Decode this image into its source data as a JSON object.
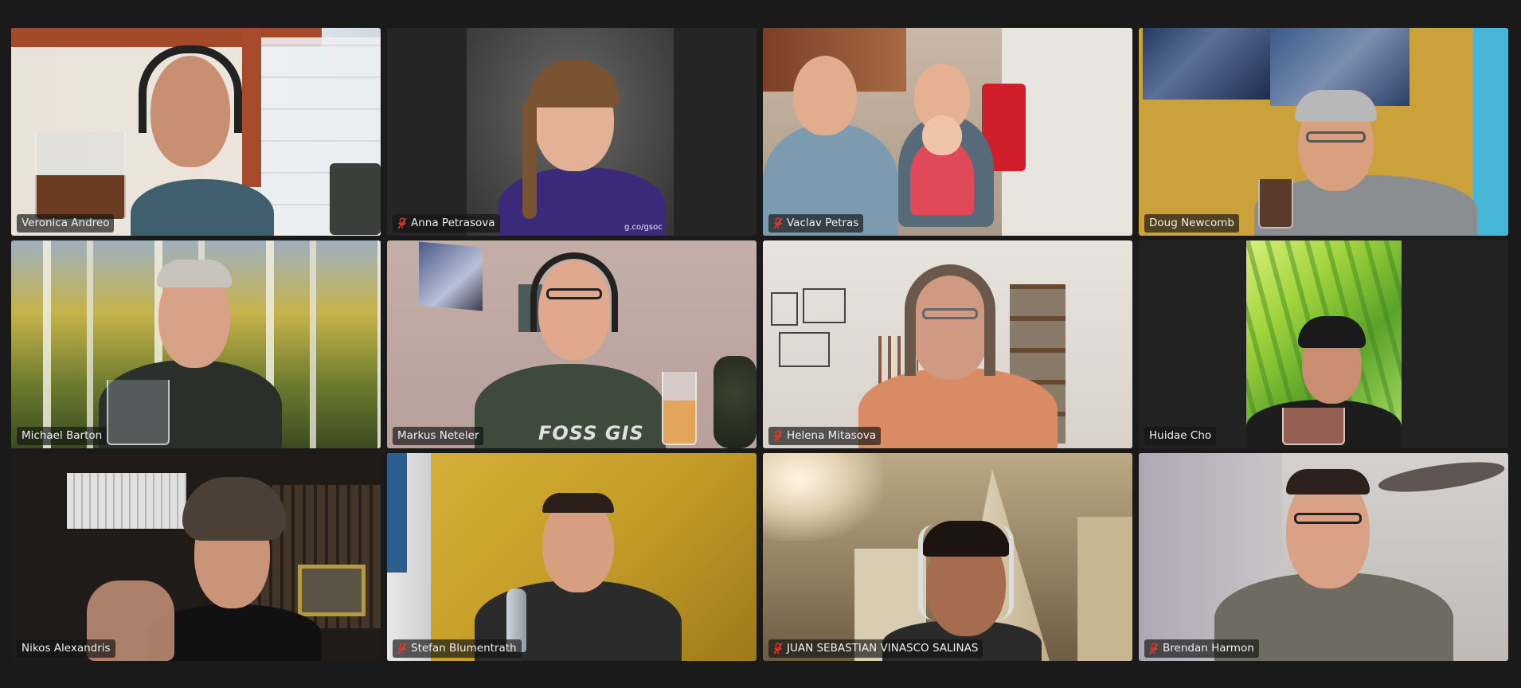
{
  "participants": [
    {
      "name": "Veronica Andreo",
      "muted": false
    },
    {
      "name": "Anna Petrasova",
      "muted": true
    },
    {
      "name": "Vaclav Petras",
      "muted": true
    },
    {
      "name": "Doug Newcomb",
      "muted": false
    },
    {
      "name": "Michael Barton",
      "muted": false,
      "active_speaker": true
    },
    {
      "name": "Markus Neteler",
      "muted": false
    },
    {
      "name": "Helena Mitasova",
      "muted": true
    },
    {
      "name": "Huidae Cho",
      "muted": false
    },
    {
      "name": "Nikos Alexandris",
      "muted": false
    },
    {
      "name": "Stefan Blumentrath",
      "muted": true
    },
    {
      "name": "JUAN SEBASTIAN VINASCO SALINAS",
      "muted": true
    },
    {
      "name": "Brendan Harmon",
      "muted": true
    }
  ],
  "colors": {
    "background": "#1a1a1a",
    "active_speaker_border": "#23d959",
    "mute_icon": "#e0392b"
  },
  "shirt_text": {
    "anna": "g.co/gsoc",
    "markus": "FOSS GIS"
  }
}
